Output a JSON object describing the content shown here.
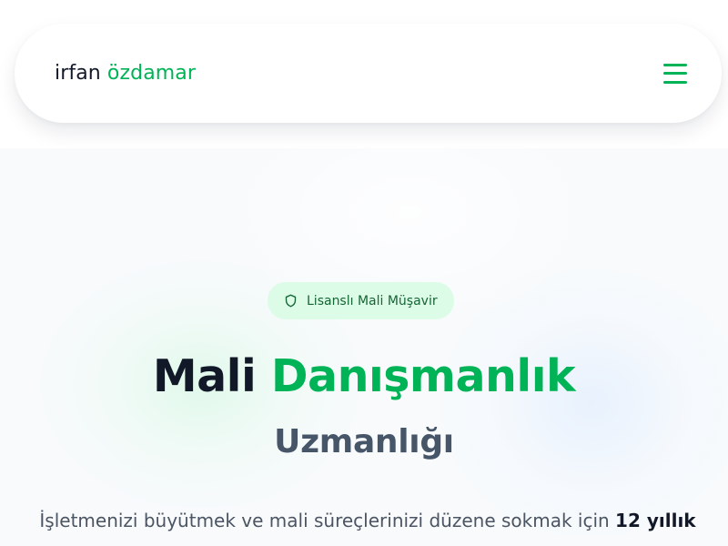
{
  "header": {
    "logo": {
      "first": "irfan",
      "last": "özdamar"
    },
    "menu_icon": "hamburger-menu-icon"
  },
  "hero": {
    "badge": {
      "icon": "shield-icon",
      "label": "Lisanslı Mali Müşavir"
    },
    "title": {
      "dark": "Mali",
      "green": "Danışmanlık"
    },
    "subtitle": "Uzmanlığı",
    "description": {
      "text": "İşletmenizi büyütmek ve mali süreçlerinizi düzene sokmak için",
      "emphasis": "12 yıllık"
    }
  },
  "colors": {
    "accent": "#00b356",
    "text_dark": "#111827",
    "text_muted": "#475569",
    "badge_bg": "#dcfce7",
    "badge_text": "#166534",
    "hero_bg": "#f8fafc"
  }
}
